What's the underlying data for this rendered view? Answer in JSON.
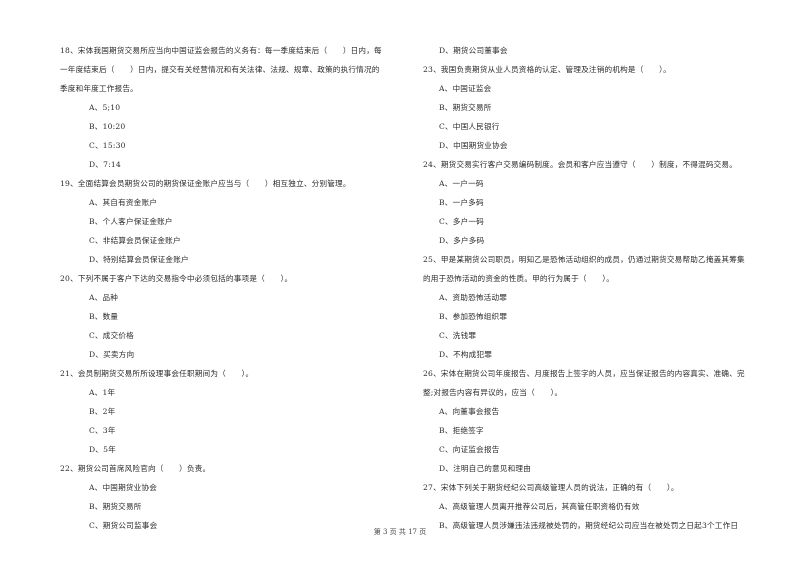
{
  "document": {
    "left_column": [
      {
        "type": "question",
        "lines": [
          "18、宋体我国期货交易所应当向中国证监会报告的义务有：每一季度结束后（　　）日内，每",
          "一年度结束后（　　）日内，提交有关经营情况和有关法律、法规、规章、政策的执行情况的",
          "季度和年度工作报告。"
        ]
      },
      {
        "type": "option",
        "text": "A、5;10"
      },
      {
        "type": "option",
        "text": "B、10:20"
      },
      {
        "type": "option",
        "text": "C、15:30"
      },
      {
        "type": "option",
        "text": "D、7:14"
      },
      {
        "type": "question",
        "lines": [
          "19、全面结算会员期货公司的期货保证金账户应当与（　　）相互独立、分别管理。"
        ]
      },
      {
        "type": "option",
        "text": "A、其自有资金账户"
      },
      {
        "type": "option",
        "text": "B、个人客户保证金账户"
      },
      {
        "type": "option",
        "text": "C、非结算会员保证金账户"
      },
      {
        "type": "option",
        "text": "D、特别结算会员保证金账户"
      },
      {
        "type": "question",
        "lines": [
          "20、下列不属于客户下达的交易指令中必须包括的事项是（　　）。"
        ]
      },
      {
        "type": "option",
        "text": "A、品种"
      },
      {
        "type": "option",
        "text": "B、数量"
      },
      {
        "type": "option",
        "text": "C、成交价格"
      },
      {
        "type": "option",
        "text": "D、买卖方向"
      },
      {
        "type": "question",
        "lines": [
          "21、会员制期货交易所所设理事会任职期间为（　　）。"
        ]
      },
      {
        "type": "option",
        "text": "A、1年"
      },
      {
        "type": "option",
        "text": "B、2年"
      },
      {
        "type": "option",
        "text": "C、3年"
      },
      {
        "type": "option",
        "text": "D、5年"
      },
      {
        "type": "question",
        "lines": [
          "22、期货公司首席风险官向（　　）负责。"
        ]
      },
      {
        "type": "option",
        "text": "A、中国期货业协会"
      },
      {
        "type": "option",
        "text": "B、期货交易所"
      },
      {
        "type": "option",
        "text": "C、期货公司监事会"
      }
    ],
    "right_column": [
      {
        "type": "option",
        "text": "D、期货公司董事会"
      },
      {
        "type": "question",
        "lines": [
          "23、我国负责期货从业人员资格的认定、管理及注销的机构是（　　）。"
        ]
      },
      {
        "type": "option",
        "text": "A、中国证监会"
      },
      {
        "type": "option",
        "text": "B、期货交易所"
      },
      {
        "type": "option",
        "text": "C、中国人民银行"
      },
      {
        "type": "option",
        "text": "D、中国期货业协会"
      },
      {
        "type": "question",
        "lines": [
          "24、期货交易实行客户交易编码制度。会员和客户应当遵守（　　）制度，不得混码交易。"
        ]
      },
      {
        "type": "option",
        "text": "A、一户一码"
      },
      {
        "type": "option",
        "text": "B、一户多码"
      },
      {
        "type": "option",
        "text": "C、多户一码"
      },
      {
        "type": "option",
        "text": "D、多户多码"
      },
      {
        "type": "question",
        "lines": [
          "25、甲是某期货公司职员，明知乙是恐怖活动组织的成员，仍通过期货交易帮助乙掩盖其筹集",
          "的用于恐怖活动的资金的性质。甲的行为属于（　　）。"
        ]
      },
      {
        "type": "option",
        "text": "A、资助恐怖活动罪"
      },
      {
        "type": "option",
        "text": "B、参加恐怖组织罪"
      },
      {
        "type": "option",
        "text": "C、洗钱罪"
      },
      {
        "type": "option",
        "text": "D、不构成犯罪"
      },
      {
        "type": "question",
        "lines": [
          "26、宋体在期货公司年度报告、月度报告上签字的人员，应当保证报告的内容真实、准确、完",
          "整;对报告内容有异议的，应当（　　）。"
        ]
      },
      {
        "type": "option",
        "text": "A、向董事会报告"
      },
      {
        "type": "option",
        "text": "B、拒绝签字"
      },
      {
        "type": "option",
        "text": "C、向证监会报告"
      },
      {
        "type": "option",
        "text": "D、注明自己的意见和理由"
      },
      {
        "type": "question",
        "lines": [
          "27、宋体下列关于期货经纪公司高级管理人员的说法，正确的有（　　）。"
        ]
      },
      {
        "type": "option",
        "text": "A、高级管理人员离开推荐公司后，其高管任职资格仍有效"
      },
      {
        "type": "option",
        "text": "B、高级管理人员涉嫌违法违规被处罚的，期货经纪公司应当在被处罚之日起3个工作日"
      }
    ]
  },
  "footer": {
    "page_label": "第 3 页 共 17 页"
  }
}
